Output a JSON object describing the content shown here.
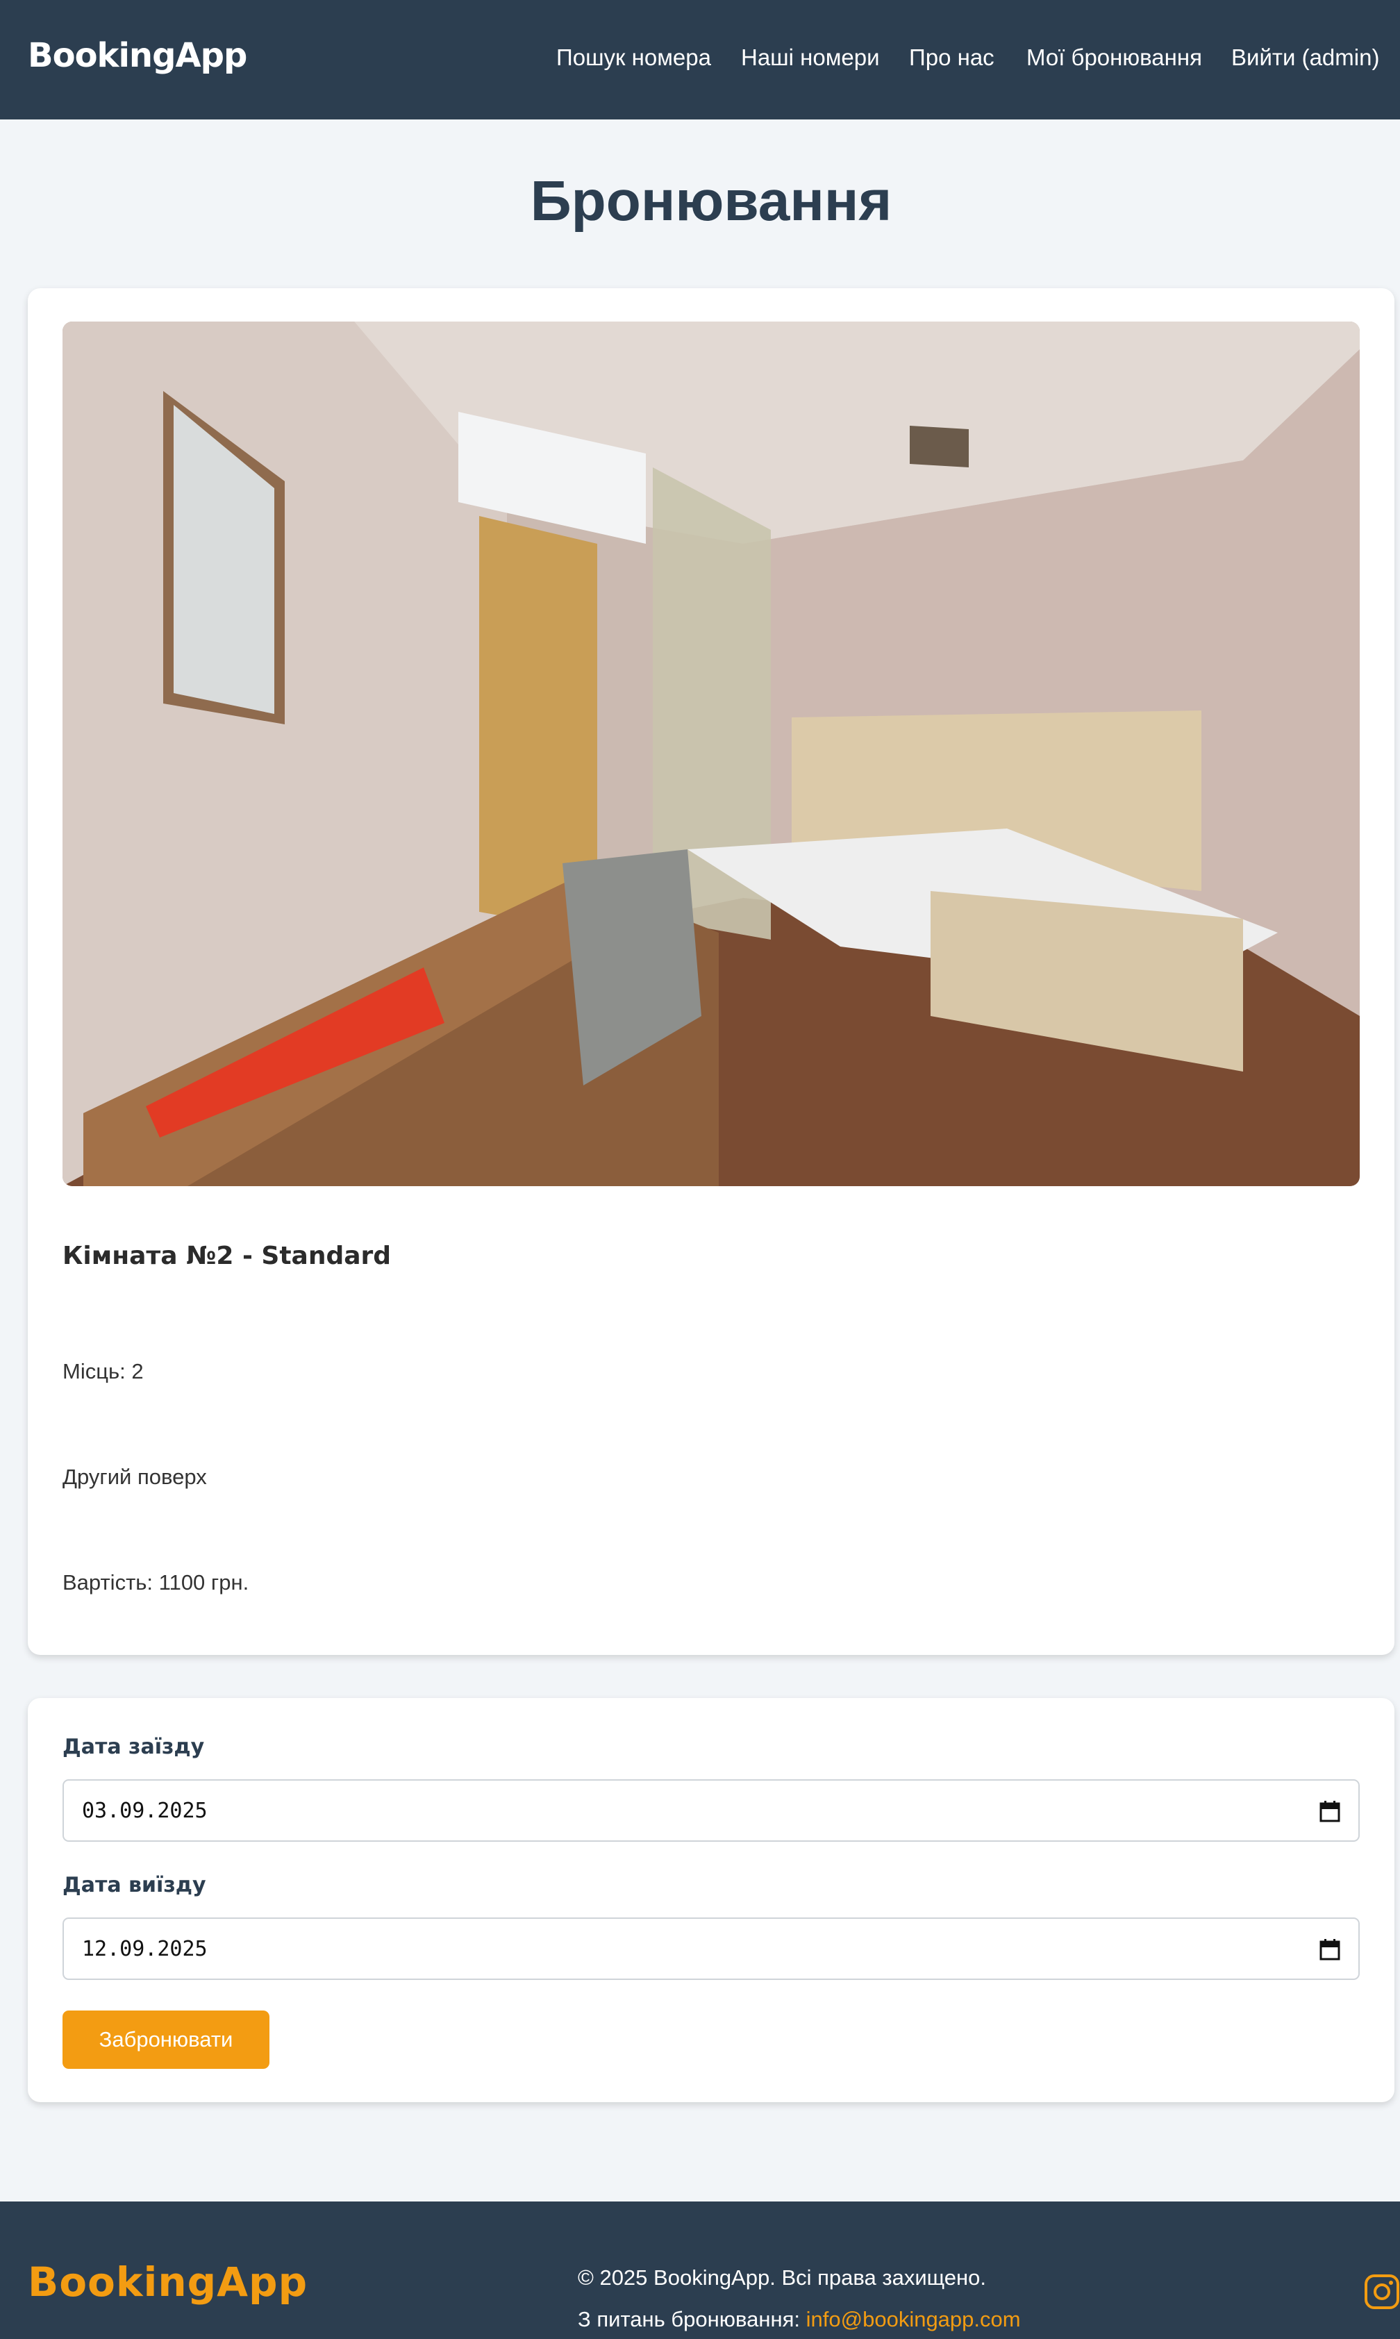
{
  "header": {
    "brand": "BookingApp",
    "nav": [
      "Пошук номера",
      "Наші номери",
      "Про нас",
      "Мої бронювання",
      "Вийти (admin)"
    ]
  },
  "page": {
    "title": "Бронювання"
  },
  "room": {
    "title": "Кімната №2 - Standard",
    "places": "Місць: 2",
    "description": "Другий поверх",
    "price": "Вартість: 1100 грн."
  },
  "form": {
    "checkin_label": "Дата заїзду",
    "checkin_value": "03.09.2025",
    "checkout_label": "Дата виїзду",
    "checkout_value": "12.09.2025",
    "submit_label": "Забронювати"
  },
  "footer": {
    "brand": "BookingApp",
    "copyright": "© 2025 BookingApp. Всі права захищено.",
    "contact_prefix": "З питань бронювання: ",
    "contact_email": "info@bookingapp.com"
  },
  "icons": {
    "calendar": "calendar-icon",
    "instagram": "instagram-icon"
  },
  "colors": {
    "header_bg": "#2c3e50",
    "accent": "#f39c12",
    "page_bg": "#f2f5f8"
  }
}
